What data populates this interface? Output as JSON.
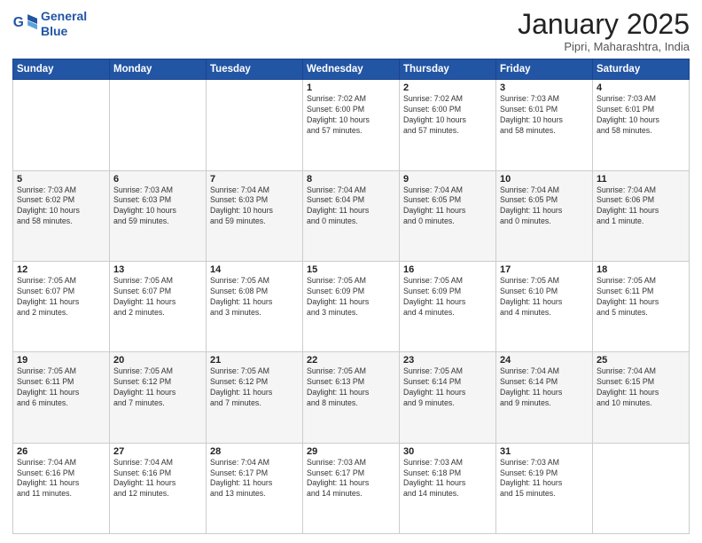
{
  "header": {
    "logo_line1": "General",
    "logo_line2": "Blue",
    "month": "January 2025",
    "location": "Pipri, Maharashtra, India"
  },
  "weekdays": [
    "Sunday",
    "Monday",
    "Tuesday",
    "Wednesday",
    "Thursday",
    "Friday",
    "Saturday"
  ],
  "weeks": [
    [
      {
        "day": "",
        "info": ""
      },
      {
        "day": "",
        "info": ""
      },
      {
        "day": "",
        "info": ""
      },
      {
        "day": "1",
        "info": "Sunrise: 7:02 AM\nSunset: 6:00 PM\nDaylight: 10 hours\nand 57 minutes."
      },
      {
        "day": "2",
        "info": "Sunrise: 7:02 AM\nSunset: 6:00 PM\nDaylight: 10 hours\nand 57 minutes."
      },
      {
        "day": "3",
        "info": "Sunrise: 7:03 AM\nSunset: 6:01 PM\nDaylight: 10 hours\nand 58 minutes."
      },
      {
        "day": "4",
        "info": "Sunrise: 7:03 AM\nSunset: 6:01 PM\nDaylight: 10 hours\nand 58 minutes."
      }
    ],
    [
      {
        "day": "5",
        "info": "Sunrise: 7:03 AM\nSunset: 6:02 PM\nDaylight: 10 hours\nand 58 minutes."
      },
      {
        "day": "6",
        "info": "Sunrise: 7:03 AM\nSunset: 6:03 PM\nDaylight: 10 hours\nand 59 minutes."
      },
      {
        "day": "7",
        "info": "Sunrise: 7:04 AM\nSunset: 6:03 PM\nDaylight: 10 hours\nand 59 minutes."
      },
      {
        "day": "8",
        "info": "Sunrise: 7:04 AM\nSunset: 6:04 PM\nDaylight: 11 hours\nand 0 minutes."
      },
      {
        "day": "9",
        "info": "Sunrise: 7:04 AM\nSunset: 6:05 PM\nDaylight: 11 hours\nand 0 minutes."
      },
      {
        "day": "10",
        "info": "Sunrise: 7:04 AM\nSunset: 6:05 PM\nDaylight: 11 hours\nand 0 minutes."
      },
      {
        "day": "11",
        "info": "Sunrise: 7:04 AM\nSunset: 6:06 PM\nDaylight: 11 hours\nand 1 minute."
      }
    ],
    [
      {
        "day": "12",
        "info": "Sunrise: 7:05 AM\nSunset: 6:07 PM\nDaylight: 11 hours\nand 2 minutes."
      },
      {
        "day": "13",
        "info": "Sunrise: 7:05 AM\nSunset: 6:07 PM\nDaylight: 11 hours\nand 2 minutes."
      },
      {
        "day": "14",
        "info": "Sunrise: 7:05 AM\nSunset: 6:08 PM\nDaylight: 11 hours\nand 3 minutes."
      },
      {
        "day": "15",
        "info": "Sunrise: 7:05 AM\nSunset: 6:09 PM\nDaylight: 11 hours\nand 3 minutes."
      },
      {
        "day": "16",
        "info": "Sunrise: 7:05 AM\nSunset: 6:09 PM\nDaylight: 11 hours\nand 4 minutes."
      },
      {
        "day": "17",
        "info": "Sunrise: 7:05 AM\nSunset: 6:10 PM\nDaylight: 11 hours\nand 4 minutes."
      },
      {
        "day": "18",
        "info": "Sunrise: 7:05 AM\nSunset: 6:11 PM\nDaylight: 11 hours\nand 5 minutes."
      }
    ],
    [
      {
        "day": "19",
        "info": "Sunrise: 7:05 AM\nSunset: 6:11 PM\nDaylight: 11 hours\nand 6 minutes."
      },
      {
        "day": "20",
        "info": "Sunrise: 7:05 AM\nSunset: 6:12 PM\nDaylight: 11 hours\nand 7 minutes."
      },
      {
        "day": "21",
        "info": "Sunrise: 7:05 AM\nSunset: 6:12 PM\nDaylight: 11 hours\nand 7 minutes."
      },
      {
        "day": "22",
        "info": "Sunrise: 7:05 AM\nSunset: 6:13 PM\nDaylight: 11 hours\nand 8 minutes."
      },
      {
        "day": "23",
        "info": "Sunrise: 7:05 AM\nSunset: 6:14 PM\nDaylight: 11 hours\nand 9 minutes."
      },
      {
        "day": "24",
        "info": "Sunrise: 7:04 AM\nSunset: 6:14 PM\nDaylight: 11 hours\nand 9 minutes."
      },
      {
        "day": "25",
        "info": "Sunrise: 7:04 AM\nSunset: 6:15 PM\nDaylight: 11 hours\nand 10 minutes."
      }
    ],
    [
      {
        "day": "26",
        "info": "Sunrise: 7:04 AM\nSunset: 6:16 PM\nDaylight: 11 hours\nand 11 minutes."
      },
      {
        "day": "27",
        "info": "Sunrise: 7:04 AM\nSunset: 6:16 PM\nDaylight: 11 hours\nand 12 minutes."
      },
      {
        "day": "28",
        "info": "Sunrise: 7:04 AM\nSunset: 6:17 PM\nDaylight: 11 hours\nand 13 minutes."
      },
      {
        "day": "29",
        "info": "Sunrise: 7:03 AM\nSunset: 6:17 PM\nDaylight: 11 hours\nand 14 minutes."
      },
      {
        "day": "30",
        "info": "Sunrise: 7:03 AM\nSunset: 6:18 PM\nDaylight: 11 hours\nand 14 minutes."
      },
      {
        "day": "31",
        "info": "Sunrise: 7:03 AM\nSunset: 6:19 PM\nDaylight: 11 hours\nand 15 minutes."
      },
      {
        "day": "",
        "info": ""
      }
    ]
  ]
}
